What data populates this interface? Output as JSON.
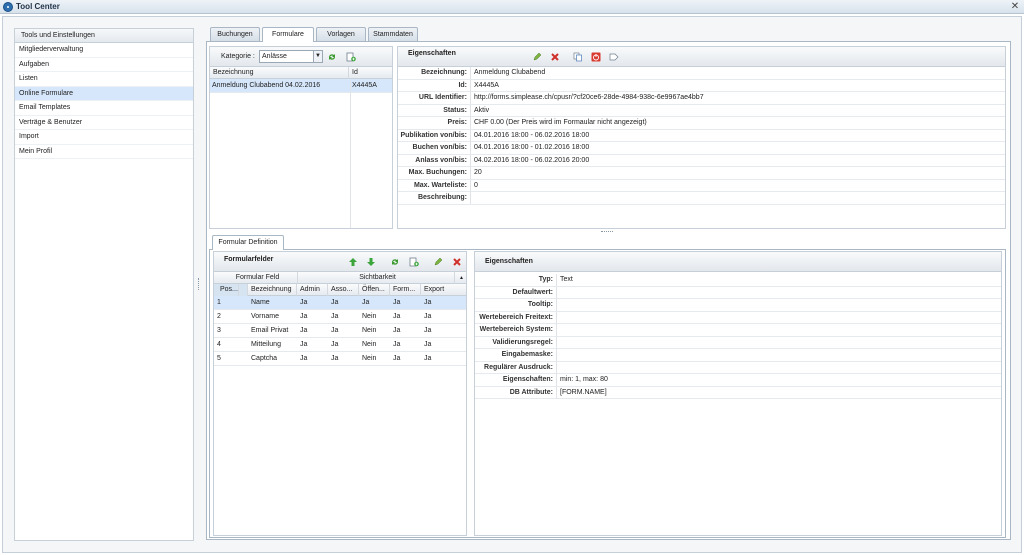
{
  "app": {
    "title": "Tool Center"
  },
  "sidebar": {
    "header": "Tools und Einstellungen",
    "items": [
      {
        "label": "Mitgliederverwaltung"
      },
      {
        "label": "Aufgaben"
      },
      {
        "label": "Listen"
      },
      {
        "label": "Online Formulare"
      },
      {
        "label": "Email Templates"
      },
      {
        "label": "Verträge & Benutzer"
      },
      {
        "label": "Import"
      },
      {
        "label": "Mein Profil"
      }
    ]
  },
  "tabs": [
    {
      "label": "Buchungen"
    },
    {
      "label": "Formulare"
    },
    {
      "label": "Vorlagen"
    },
    {
      "label": "Stammdaten"
    }
  ],
  "formlist": {
    "kategorie_label": "Kategorie :",
    "kategorie_value": "Anlässe",
    "columns": [
      "Bezeichnung",
      "Id"
    ],
    "rows": [
      {
        "name": "Anmeldung Clubabend 04.02.2016",
        "id": "X4445A"
      }
    ]
  },
  "props": {
    "title": "Eigenschaften",
    "rows": [
      {
        "label": "Bezeichnung:",
        "value": "Anmeldung Clubabend"
      },
      {
        "label": "Id:",
        "value": "X4445A"
      },
      {
        "label": "URL Identifier:",
        "value": "http://forms.simplease.ch/cpusr/?cf20ce6-28de-4984-938c-6e9967ae4bb7"
      },
      {
        "label": "Status:",
        "value": "Aktiv"
      },
      {
        "label": "Preis:",
        "value": "CHF 0.00 (Der Preis wird im Formaular nicht angezeigt)"
      },
      {
        "label": "Publikation von/bis:",
        "value": "04.01.2016 18:00 - 06.02.2016 18:00"
      },
      {
        "label": "Buchen von/bis:",
        "value": "04.01.2016 18:00 - 01.02.2016 18:00"
      },
      {
        "label": "Anlass von/bis:",
        "value": "04.02.2016 18:00 - 06.02.2016 20:00"
      },
      {
        "label": "Max. Buchungen:",
        "value": "20"
      },
      {
        "label": "Max. Warteliste:",
        "value": "0"
      },
      {
        "label": "Beschreibung:",
        "value": ""
      }
    ]
  },
  "definition": {
    "tab": "Formular Definition",
    "fields_title": "Formularfelder",
    "group_headers": [
      "Formular Feld",
      "Sichtbarkeit"
    ],
    "columns": [
      "Pos...",
      "Bezeichnung",
      "Admin",
      "Asso...",
      "Öffen...",
      "Form...",
      "Export"
    ],
    "rows": [
      {
        "pos": "1",
        "name": "Name",
        "admin": "Ja",
        "asso": "Ja",
        "offen": "Ja",
        "form": "Ja",
        "export": "Ja"
      },
      {
        "pos": "2",
        "name": "Vorname",
        "admin": "Ja",
        "asso": "Ja",
        "offen": "Nein",
        "form": "Ja",
        "export": "Ja"
      },
      {
        "pos": "3",
        "name": "Email Privat",
        "admin": "Ja",
        "asso": "Ja",
        "offen": "Nein",
        "form": "Ja",
        "export": "Ja"
      },
      {
        "pos": "4",
        "name": "Mitteilung",
        "admin": "Ja",
        "asso": "Ja",
        "offen": "Nein",
        "form": "Ja",
        "export": "Ja"
      },
      {
        "pos": "5",
        "name": "Captcha",
        "admin": "Ja",
        "asso": "Ja",
        "offen": "Nein",
        "form": "Ja",
        "export": "Ja"
      }
    ]
  },
  "field_props": {
    "title": "Eigenschaften",
    "rows": [
      {
        "label": "Typ:",
        "value": "Text"
      },
      {
        "label": "Defaultwert:",
        "value": ""
      },
      {
        "label": "Tooltip:",
        "value": ""
      },
      {
        "label": "Wertebereich Freitext:",
        "value": ""
      },
      {
        "label": "Wertebereich System:",
        "value": ""
      },
      {
        "label": "Validierungsregel:",
        "value": ""
      },
      {
        "label": "Eingabemaske:",
        "value": ""
      },
      {
        "label": "Regulärer Ausdruck:",
        "value": ""
      },
      {
        "label": "Eigenschaften:",
        "value": "min: 1, max: 80"
      },
      {
        "label": "DB Attribute:",
        "value": "[FORM.NAME]"
      }
    ]
  }
}
